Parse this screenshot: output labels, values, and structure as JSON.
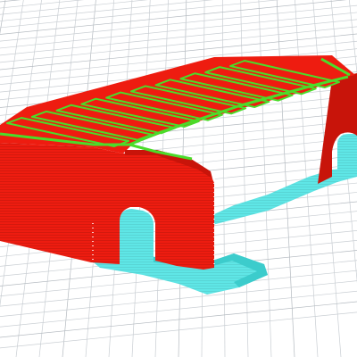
{
  "viewport": {
    "background_color": "#ffffff",
    "grid_line_color": "#c9ced3",
    "grid_line_color_major": "#b4bac0"
  },
  "model": {
    "wall_color": "#ee1c10",
    "wall_shade_color": "#c8140a",
    "top_edge_color": "#4bdc2a",
    "support_color": "#5fe6e6",
    "support_shade_color": "#3ccccc",
    "ridge_count": 10
  }
}
